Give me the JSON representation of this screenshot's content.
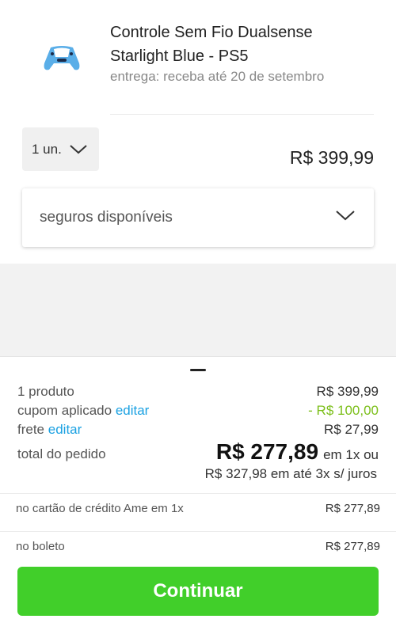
{
  "product": {
    "title": "Controle Sem Fio Dualsense Starlight Blue - PS5",
    "delivery": "entrega: receba até 20 de setembro",
    "quantity": "1 un.",
    "price": "R$ 399,99",
    "image_color": "#5aaee8"
  },
  "insurance": {
    "label": "seguros disponíveis"
  },
  "summary": {
    "products_label": "1 produto",
    "products_value": "R$ 399,99",
    "coupon_label": "cupom aplicado",
    "coupon_edit": "editar",
    "coupon_value": "- R$ 100,00",
    "shipping_label": "frete",
    "shipping_edit": "editar",
    "shipping_value": "R$ 27,99",
    "total_label": "total do pedido",
    "total_value": "R$ 277,89",
    "total_suffix": "em 1x ou",
    "installments": "R$ 327,98 em até 3x s/ juros"
  },
  "payment_options": [
    {
      "label": "no cartão de crédito Ame em 1x",
      "value": "R$ 277,89"
    },
    {
      "label": "no boleto",
      "value": "R$ 277,89"
    }
  ],
  "cta": {
    "label": "Continuar"
  },
  "colors": {
    "accent_green": "#41cf2a",
    "link_blue": "#1ba1e2",
    "discount_green": "#7cbf1a"
  }
}
